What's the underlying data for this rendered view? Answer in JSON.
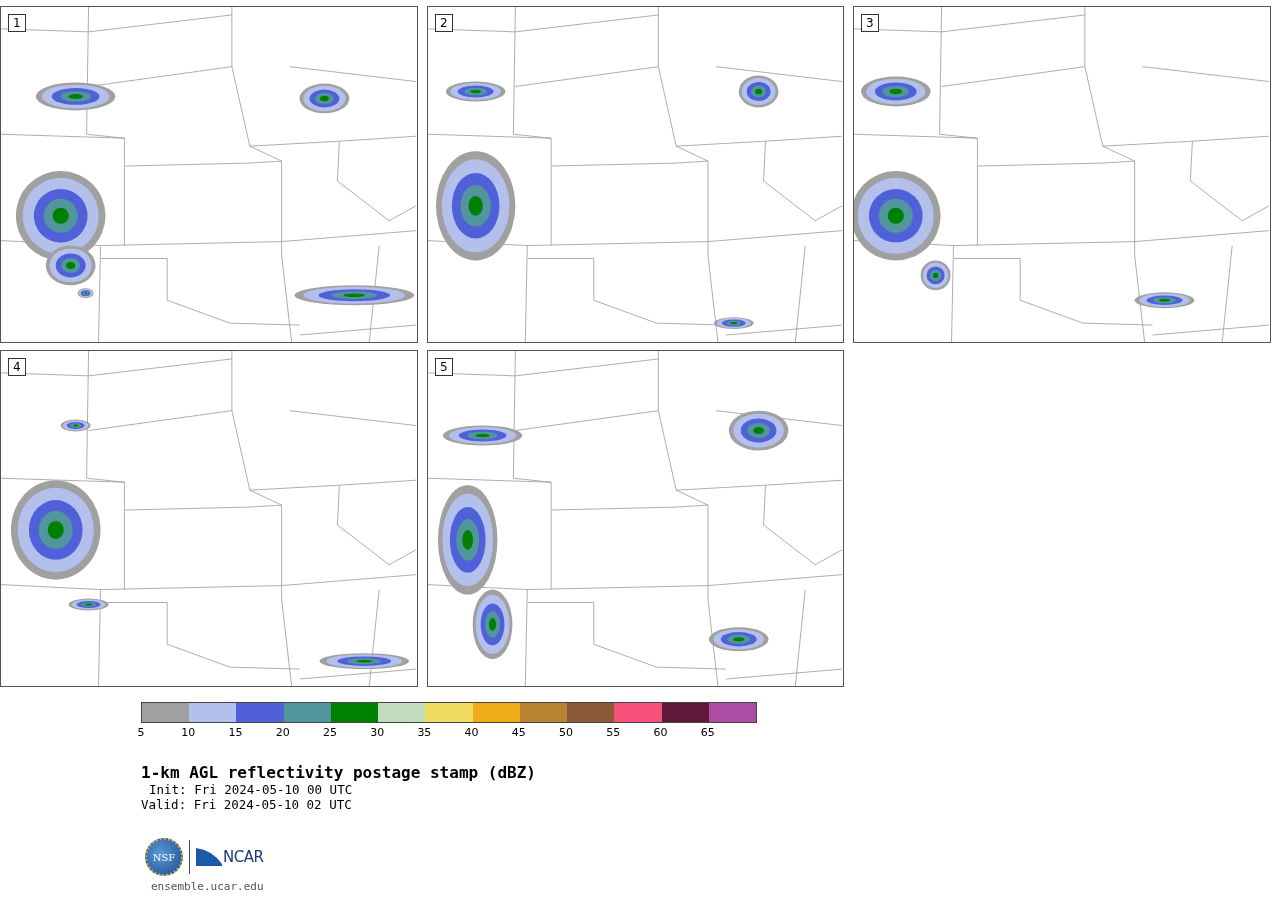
{
  "panels": [
    {
      "label": "1"
    },
    {
      "label": "2"
    },
    {
      "label": "3"
    },
    {
      "label": "4"
    },
    {
      "label": "5"
    }
  ],
  "colorbar": {
    "bins": [
      {
        "color": "#a0a0a0"
      },
      {
        "color": "#b4c0ec"
      },
      {
        "color": "#5060d8"
      },
      {
        "color": "#50969c"
      },
      {
        "color": "#008000"
      },
      {
        "color": "#c0dcbc"
      },
      {
        "color": "#f0dc60"
      },
      {
        "color": "#f0ac18"
      },
      {
        "color": "#b88430"
      },
      {
        "color": "#885838"
      },
      {
        "color": "#f45078"
      },
      {
        "color": "#601838"
      },
      {
        "color": "#ac4ca4"
      }
    ],
    "ticks": [
      "5",
      "10",
      "15",
      "20",
      "25",
      "30",
      "35",
      "40",
      "45",
      "50",
      "55",
      "60",
      "65"
    ]
  },
  "title": "1-km AGL reflectivity postage stamp (dBZ)",
  "init": "Init: Fri 2024-05-10 00 UTC",
  "valid": "Valid: Fri 2024-05-10 02 UTC",
  "logos": {
    "nsf": "NSF",
    "ncar": "NCAR"
  },
  "url": "ensemble.ucar.edu"
}
